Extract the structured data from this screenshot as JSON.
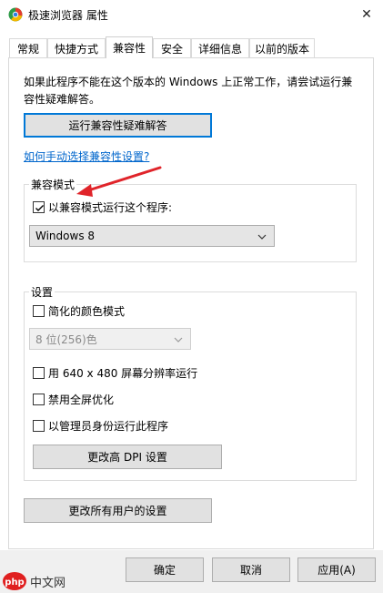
{
  "window": {
    "title": "极速浏览器 属性",
    "close_glyph": "✕"
  },
  "tabs": [
    {
      "label": "常规"
    },
    {
      "label": "快捷方式"
    },
    {
      "label": "兼容性",
      "active": true
    },
    {
      "label": "安全"
    },
    {
      "label": "详细信息"
    },
    {
      "label": "以前的版本"
    }
  ],
  "compat": {
    "note_line1": "如果此程序不能在这个版本的 Windows 上正常工作，请尝试运行兼",
    "note_line2": "容性疑难解答。",
    "troubleshoot_button": "运行兼容性疑难解答",
    "manual_link": "如何手动选择兼容性设置?"
  },
  "compat_mode": {
    "group_label": "兼容模式",
    "checkbox_label": "以兼容模式运行这个程序:",
    "checked": true,
    "os_selected": "Windows 8"
  },
  "settings": {
    "group_label": "设置",
    "reduced_color": {
      "label": "简化的颜色模式",
      "checked": false
    },
    "color_selected": "8 位(256)色",
    "res_640": {
      "label": "用 640 x 480 屏幕分辨率运行",
      "checked": false
    },
    "disable_fullscreen": {
      "label": "禁用全屏优化",
      "checked": false
    },
    "run_admin": {
      "label": "以管理员身份运行此程序",
      "checked": false
    },
    "dpi_button": "更改高 DPI 设置"
  },
  "all_users_button": "更改所有用户的设置",
  "footer": {
    "ok": "确定",
    "cancel": "取消",
    "apply": "应用(A)"
  },
  "watermark": {
    "brand": "中文网"
  },
  "colors": {
    "accent": "#0078d7",
    "link": "#0066cc",
    "arrow": "#e0242a"
  }
}
